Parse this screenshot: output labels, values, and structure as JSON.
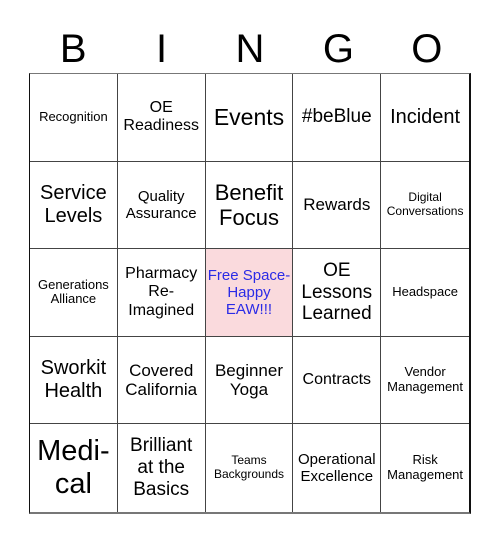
{
  "header": {
    "letters": [
      "B",
      "I",
      "N",
      "G",
      "O"
    ]
  },
  "colors": {
    "free_bg": "#fadadd",
    "free_text": "#2b2be6",
    "grid": "#444444"
  },
  "cells": [
    [
      "Recognition",
      "OE Readiness",
      "Events",
      "#beBlue",
      "Incident"
    ],
    [
      "Service Levels",
      "Quality Assurance",
      "Benefit Focus",
      "Rewards",
      "Digital Conversations"
    ],
    [
      "Generations Alliance",
      "Pharmacy Re-Imagined",
      "Free Space-Happy EAW!!!",
      "OE Lessons Learned",
      "Headspace"
    ],
    [
      "Sworkit Health",
      "Covered California",
      "Beginner Yoga",
      "Contracts",
      "Vendor Management"
    ],
    [
      "Medi-cal",
      "Brilliant at the Basics",
      "Teams Backgrounds",
      "Operational Excellence",
      "Risk Management"
    ]
  ],
  "free_space": {
    "row": 2,
    "col": 2
  }
}
